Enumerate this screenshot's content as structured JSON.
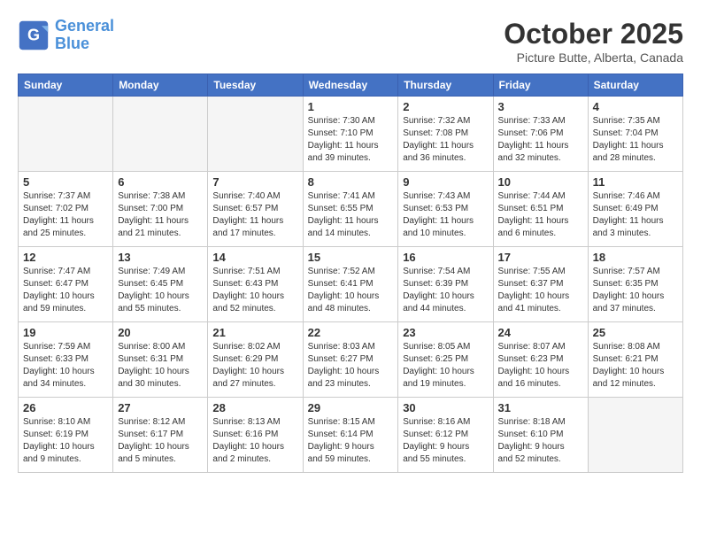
{
  "header": {
    "logo_line1": "General",
    "logo_line2": "Blue",
    "month": "October 2025",
    "location": "Picture Butte, Alberta, Canada"
  },
  "days": [
    "Sunday",
    "Monday",
    "Tuesday",
    "Wednesday",
    "Thursday",
    "Friday",
    "Saturday"
  ],
  "weeks": [
    [
      {
        "date": "",
        "info": ""
      },
      {
        "date": "",
        "info": ""
      },
      {
        "date": "",
        "info": ""
      },
      {
        "date": "1",
        "info": "Sunrise: 7:30 AM\nSunset: 7:10 PM\nDaylight: 11 hours\nand 39 minutes."
      },
      {
        "date": "2",
        "info": "Sunrise: 7:32 AM\nSunset: 7:08 PM\nDaylight: 11 hours\nand 36 minutes."
      },
      {
        "date": "3",
        "info": "Sunrise: 7:33 AM\nSunset: 7:06 PM\nDaylight: 11 hours\nand 32 minutes."
      },
      {
        "date": "4",
        "info": "Sunrise: 7:35 AM\nSunset: 7:04 PM\nDaylight: 11 hours\nand 28 minutes."
      }
    ],
    [
      {
        "date": "5",
        "info": "Sunrise: 7:37 AM\nSunset: 7:02 PM\nDaylight: 11 hours\nand 25 minutes."
      },
      {
        "date": "6",
        "info": "Sunrise: 7:38 AM\nSunset: 7:00 PM\nDaylight: 11 hours\nand 21 minutes."
      },
      {
        "date": "7",
        "info": "Sunrise: 7:40 AM\nSunset: 6:57 PM\nDaylight: 11 hours\nand 17 minutes."
      },
      {
        "date": "8",
        "info": "Sunrise: 7:41 AM\nSunset: 6:55 PM\nDaylight: 11 hours\nand 14 minutes."
      },
      {
        "date": "9",
        "info": "Sunrise: 7:43 AM\nSunset: 6:53 PM\nDaylight: 11 hours\nand 10 minutes."
      },
      {
        "date": "10",
        "info": "Sunrise: 7:44 AM\nSunset: 6:51 PM\nDaylight: 11 hours\nand 6 minutes."
      },
      {
        "date": "11",
        "info": "Sunrise: 7:46 AM\nSunset: 6:49 PM\nDaylight: 11 hours\nand 3 minutes."
      }
    ],
    [
      {
        "date": "12",
        "info": "Sunrise: 7:47 AM\nSunset: 6:47 PM\nDaylight: 10 hours\nand 59 minutes."
      },
      {
        "date": "13",
        "info": "Sunrise: 7:49 AM\nSunset: 6:45 PM\nDaylight: 10 hours\nand 55 minutes."
      },
      {
        "date": "14",
        "info": "Sunrise: 7:51 AM\nSunset: 6:43 PM\nDaylight: 10 hours\nand 52 minutes."
      },
      {
        "date": "15",
        "info": "Sunrise: 7:52 AM\nSunset: 6:41 PM\nDaylight: 10 hours\nand 48 minutes."
      },
      {
        "date": "16",
        "info": "Sunrise: 7:54 AM\nSunset: 6:39 PM\nDaylight: 10 hours\nand 44 minutes."
      },
      {
        "date": "17",
        "info": "Sunrise: 7:55 AM\nSunset: 6:37 PM\nDaylight: 10 hours\nand 41 minutes."
      },
      {
        "date": "18",
        "info": "Sunrise: 7:57 AM\nSunset: 6:35 PM\nDaylight: 10 hours\nand 37 minutes."
      }
    ],
    [
      {
        "date": "19",
        "info": "Sunrise: 7:59 AM\nSunset: 6:33 PM\nDaylight: 10 hours\nand 34 minutes."
      },
      {
        "date": "20",
        "info": "Sunrise: 8:00 AM\nSunset: 6:31 PM\nDaylight: 10 hours\nand 30 minutes."
      },
      {
        "date": "21",
        "info": "Sunrise: 8:02 AM\nSunset: 6:29 PM\nDaylight: 10 hours\nand 27 minutes."
      },
      {
        "date": "22",
        "info": "Sunrise: 8:03 AM\nSunset: 6:27 PM\nDaylight: 10 hours\nand 23 minutes."
      },
      {
        "date": "23",
        "info": "Sunrise: 8:05 AM\nSunset: 6:25 PM\nDaylight: 10 hours\nand 19 minutes."
      },
      {
        "date": "24",
        "info": "Sunrise: 8:07 AM\nSunset: 6:23 PM\nDaylight: 10 hours\nand 16 minutes."
      },
      {
        "date": "25",
        "info": "Sunrise: 8:08 AM\nSunset: 6:21 PM\nDaylight: 10 hours\nand 12 minutes."
      }
    ],
    [
      {
        "date": "26",
        "info": "Sunrise: 8:10 AM\nSunset: 6:19 PM\nDaylight: 10 hours\nand 9 minutes."
      },
      {
        "date": "27",
        "info": "Sunrise: 8:12 AM\nSunset: 6:17 PM\nDaylight: 10 hours\nand 5 minutes."
      },
      {
        "date": "28",
        "info": "Sunrise: 8:13 AM\nSunset: 6:16 PM\nDaylight: 10 hours\nand 2 minutes."
      },
      {
        "date": "29",
        "info": "Sunrise: 8:15 AM\nSunset: 6:14 PM\nDaylight: 9 hours\nand 59 minutes."
      },
      {
        "date": "30",
        "info": "Sunrise: 8:16 AM\nSunset: 6:12 PM\nDaylight: 9 hours\nand 55 minutes."
      },
      {
        "date": "31",
        "info": "Sunrise: 8:18 AM\nSunset: 6:10 PM\nDaylight: 9 hours\nand 52 minutes."
      },
      {
        "date": "",
        "info": ""
      }
    ]
  ]
}
